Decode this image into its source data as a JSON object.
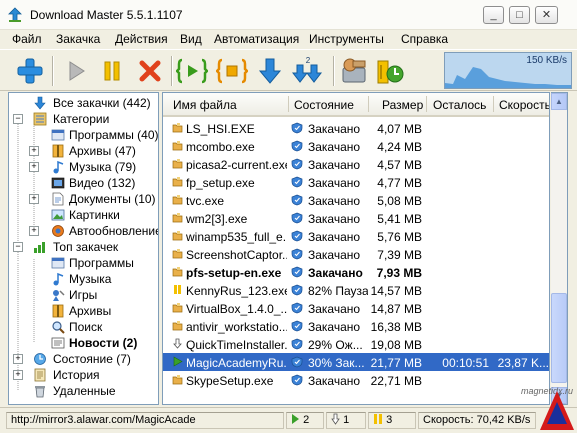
{
  "window": {
    "title": "Download Master 5.5.1.1107",
    "controls": {
      "minimize": "_",
      "maximize": "□",
      "close": "✕"
    }
  },
  "menu": [
    "Файл",
    "Закачка",
    "Действия",
    "Вид",
    "Автоматизация",
    "Инструменты",
    "Справка"
  ],
  "toolbar": {
    "buttons": [
      "add-icon",
      "start-icon",
      "pause-icon",
      "delete-icon",
      "start-all-icon",
      "stop-all-icon",
      "download-icon",
      "download-all-icon",
      "settings-icon",
      "schedule-icon"
    ],
    "download_all_badge": "2",
    "speed": "150 KB/s"
  },
  "tree": {
    "items": [
      {
        "label": "Все закачки (442)",
        "icon": "all-downloads-icon",
        "bold": false
      },
      {
        "label": "Категории",
        "icon": "categories-icon"
      },
      {
        "label": "Программы (40)",
        "icon": "programs-icon"
      },
      {
        "label": "Архивы (47)",
        "icon": "archives-icon"
      },
      {
        "label": "Музыка (79)",
        "icon": "music-icon"
      },
      {
        "label": "Видео (132)",
        "icon": "video-icon"
      },
      {
        "label": "Документы (10)",
        "icon": "documents-icon"
      },
      {
        "label": "Картинки",
        "icon": "pictures-icon"
      },
      {
        "label": "Автообновление",
        "icon": "autoupdate-icon"
      },
      {
        "label": "Топ закачек",
        "icon": "top-downloads-icon"
      },
      {
        "label": "Программы",
        "icon": "top-programs-icon"
      },
      {
        "label": "Музыка",
        "icon": "top-music-icon"
      },
      {
        "label": "Игры",
        "icon": "games-icon"
      },
      {
        "label": "Архивы",
        "icon": "top-archives-icon"
      },
      {
        "label": "Поиск",
        "icon": "search-icon"
      },
      {
        "label": "Новости (2)",
        "icon": "news-icon"
      },
      {
        "label": "Состояние (7)",
        "icon": "state-icon"
      },
      {
        "label": "История",
        "icon": "history-icon"
      },
      {
        "label": "Удаленные",
        "icon": "trash-icon"
      }
    ]
  },
  "list": {
    "columns": [
      "Имя файла",
      "Состояние",
      "Размер",
      "Осталось",
      "Скорость"
    ],
    "rows": [
      {
        "name": "LS_HSI.EXE",
        "state": "Закачано",
        "size": "4,07 MB",
        "left": "",
        "speed": ""
      },
      {
        "name": "mcombo.exe",
        "state": "Закачано",
        "size": "4,24 MB",
        "left": "",
        "speed": ""
      },
      {
        "name": "picasa2-current.exe",
        "state": "Закачано",
        "size": "4,57 MB",
        "left": "",
        "speed": ""
      },
      {
        "name": "fp_setup.exe",
        "state": "Закачано",
        "size": "4,77 MB",
        "left": "",
        "speed": ""
      },
      {
        "name": "tvc.exe",
        "state": "Закачано",
        "size": "5,08 MB",
        "left": "",
        "speed": ""
      },
      {
        "name": "wm2[3].exe",
        "state": "Закачано",
        "size": "5,41 MB",
        "left": "",
        "speed": ""
      },
      {
        "name": "winamp535_full_e...",
        "state": "Закачано",
        "size": "5,76 MB",
        "left": "",
        "speed": ""
      },
      {
        "name": "ScreenshotCaptor...",
        "state": "Закачано",
        "size": "7,39 MB",
        "left": "",
        "speed": ""
      },
      {
        "name": "pfs-setup-en.exe",
        "state": "Закачано",
        "size": "7,93 MB",
        "left": "",
        "speed": ""
      },
      {
        "name": "KennyRus_123.exe",
        "state": "82% Пауза",
        "size": "14,57 MB",
        "left": "",
        "speed": ""
      },
      {
        "name": "VirtualBox_1.4.0_...",
        "state": "Закачано",
        "size": "14,87 MB",
        "left": "",
        "speed": ""
      },
      {
        "name": "antivir_workstatio...",
        "state": "Закачано",
        "size": "16,38 MB",
        "left": "",
        "speed": ""
      },
      {
        "name": "QuickTimeInstaller...",
        "state": "29% Ож...",
        "size": "19,08 MB",
        "left": "",
        "speed": ""
      },
      {
        "name": "MagicAcademyRu...",
        "state": "30% Зак...",
        "size": "21,77 MB",
        "left": "00:10:51",
        "speed": "23,87 K..."
      },
      {
        "name": "SkypeSetup.exe",
        "state": "Закачано",
        "size": "22,71 MB",
        "left": "",
        "speed": ""
      }
    ]
  },
  "statusbar": {
    "url": "http://mirror3.alawar.com/MagicAcade",
    "active": "2",
    "queued": "1",
    "paused": "3",
    "speed": "Скорость: 70,42 KB/s"
  },
  "watermark": "magnetidx.ru"
}
